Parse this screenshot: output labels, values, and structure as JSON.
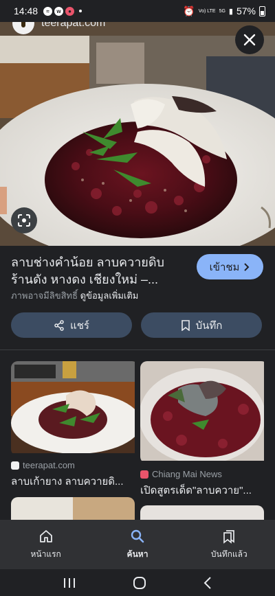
{
  "status_bar": {
    "time": "14:48",
    "signal_text": "Vo) LTE",
    "network": "5G",
    "battery": "57%"
  },
  "source_peek": {
    "site": "teerapat.com"
  },
  "detail": {
    "title": "ลาบช่างคำน้อย ลาบควายดิบร้านดัง หางดง เชียงใหม่ –...",
    "visit_label": "เข้าชม",
    "copyright": "ภาพอาจมีลิขสิทธิ์",
    "more_info": "ดูข้อมูลเพิ่มเติม",
    "share_label": "แชร์",
    "save_label": "บันทึก"
  },
  "related": [
    {
      "source": "teerapat.com",
      "title": "ลาบเก้ายาง ลาบควายดิ..."
    },
    {
      "source": "Chiang Mai News",
      "title": "เปิดสูตรเด็ด\"ลาบควาย\"..."
    }
  ],
  "bottom_nav": {
    "home": "หน้าแรก",
    "search": "ค้นหา",
    "saved": "บันทึกแล้ว"
  },
  "colors": {
    "accent": "#8ab4f8",
    "background": "#202124",
    "button": "#3c4c62"
  }
}
